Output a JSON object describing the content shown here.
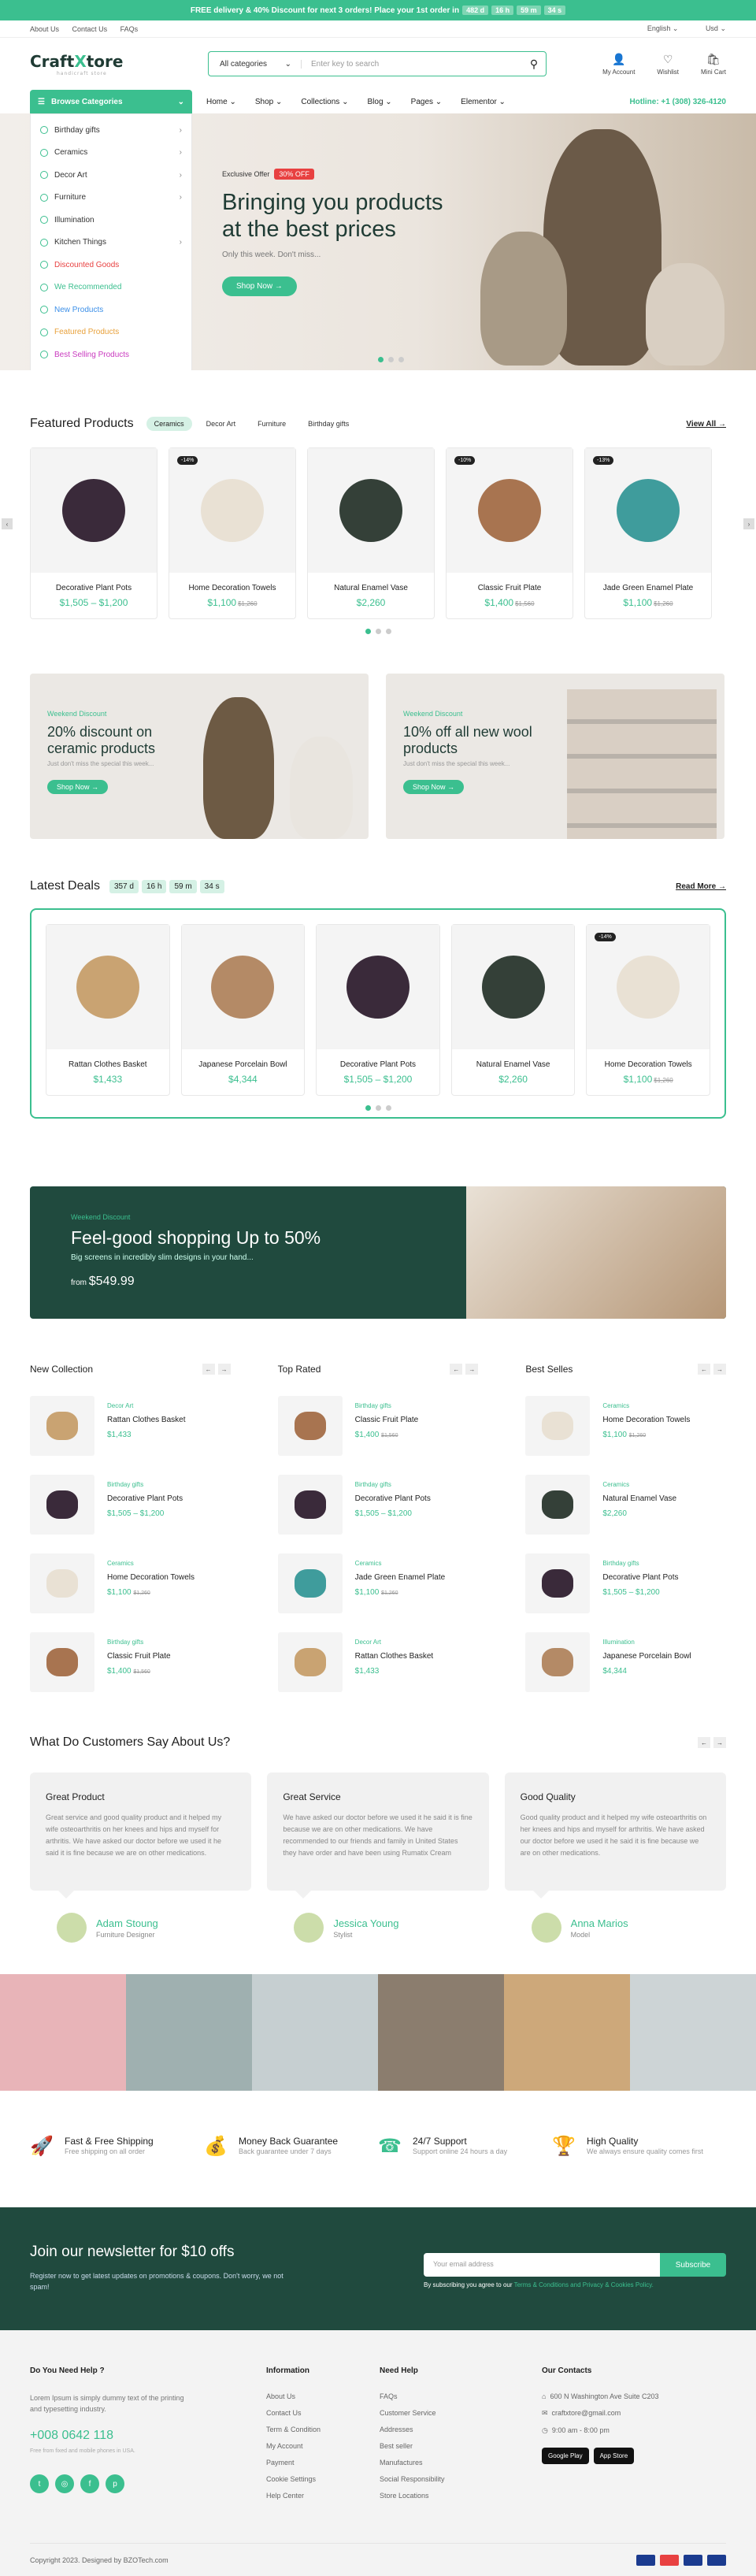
{
  "topbar": {
    "text": "FREE delivery & 40% Discount for next 3 orders! Place your 1st order in",
    "countdown": [
      "482 d",
      "16 h",
      "59 m",
      "34 s"
    ]
  },
  "util": {
    "links": [
      "About Us",
      "Contact Us",
      "FAQs"
    ],
    "language": "English",
    "currency": "Usd"
  },
  "logo": {
    "brand_a": "Craft",
    "brand_b": "X",
    "brand_c": "tore",
    "tagline": "handicraft store"
  },
  "search": {
    "category": "All categories",
    "placeholder": "Enter key to search"
  },
  "header_icons": [
    "My Account",
    "Wishlist",
    "Mini Cart"
  ],
  "browse": "Browse Categories",
  "nav": [
    "Home",
    "Shop",
    "Collections",
    "Blog",
    "Pages",
    "Elementor"
  ],
  "hotline": "Hotline: +1 (308) 326-4120",
  "categories": [
    {
      "label": "Birthday gifts",
      "arrow": true,
      "color": "#333"
    },
    {
      "label": "Ceramics",
      "arrow": true,
      "color": "#333"
    },
    {
      "label": "Decor Art",
      "arrow": true,
      "color": "#333"
    },
    {
      "label": "Furniture",
      "arrow": true,
      "color": "#333"
    },
    {
      "label": "Illumination",
      "arrow": false,
      "color": "#333"
    },
    {
      "label": "Kitchen Things",
      "arrow": true,
      "color": "#333"
    },
    {
      "label": "Discounted Goods",
      "arrow": false,
      "color": "#e84141"
    },
    {
      "label": "We Recommended",
      "arrow": false,
      "color": "#3bbf8f"
    },
    {
      "label": "New Products",
      "arrow": false,
      "color": "#3b8fe8"
    },
    {
      "label": "Featured Products",
      "arrow": false,
      "color": "#e8a13b"
    },
    {
      "label": "Best Selling Products",
      "arrow": false,
      "color": "#c93bbf"
    }
  ],
  "hero": {
    "offer": "Exclusive Offer",
    "badge": "30% OFF",
    "title_1": "Bringing you products",
    "title_2": "at the best prices",
    "subtitle": "Only this week. Don't miss...",
    "button": "Shop Now →"
  },
  "featured": {
    "title": "Featured Products",
    "tabs": [
      "Ceramics",
      "Decor Art",
      "Furniture",
      "Birthday gifts"
    ],
    "view_all": "View All →",
    "products": [
      {
        "name": "Decorative Plant Pots",
        "price": "$1,505 – $1,200",
        "old": "",
        "badge": "",
        "color": "#3a2a3a"
      },
      {
        "name": "Home Decoration Towels",
        "price": "$1,100",
        "old": "$1,260",
        "badge": "-14%",
        "color": "#e9e1d4"
      },
      {
        "name": "Natural Enamel Vase",
        "price": "$2,260",
        "old": "",
        "badge": "",
        "color": "#344038"
      },
      {
        "name": "Classic Fruit Plate",
        "price": "$1,400",
        "old": "$1,560",
        "badge": "-10%",
        "color": "#a87450"
      },
      {
        "name": "Jade Green Enamel Plate",
        "price": "$1,100",
        "old": "$1,260",
        "badge": "-13%",
        "color": "#3f9c9c"
      }
    ]
  },
  "banners": [
    {
      "tag": "Weekend Discount",
      "title_1": "20% discount on",
      "title_2": "ceramic products",
      "desc": "Just don't miss the special this week...",
      "button": "Shop Now →"
    },
    {
      "tag": "Weekend Discount",
      "title_1": "10% off all new wool",
      "title_2": "products",
      "desc": "Just don't miss the special this week...",
      "button": "Shop Now →"
    }
  ],
  "deals": {
    "title": "Latest Deals",
    "countdown": [
      "357 d",
      "16 h",
      "59 m",
      "34 s"
    ],
    "read_more": "Read More →",
    "products": [
      {
        "name": "Rattan Clothes Basket",
        "price": "$1,433",
        "old": "",
        "badge": "",
        "color": "#c9a372"
      },
      {
        "name": "Japanese Porcelain Bowl",
        "price": "$4,344",
        "old": "",
        "badge": "",
        "color": "#b48a66"
      },
      {
        "name": "Decorative Plant Pots",
        "price": "$1,505 – $1,200",
        "old": "",
        "badge": "",
        "color": "#3a2a3a"
      },
      {
        "name": "Natural Enamel Vase",
        "price": "$2,260",
        "old": "",
        "badge": "",
        "color": "#344038"
      },
      {
        "name": "Home Decoration Towels",
        "price": "$1,100",
        "old": "$1,260",
        "badge": "-14%",
        "color": "#e9e1d4"
      }
    ]
  },
  "promo": {
    "tag": "Weekend Discount",
    "title": "Feel-good shopping Up to 50%",
    "desc": "Big screens in incredibly slim designs in your hand...",
    "from": "from",
    "price": "$549.99"
  },
  "lists": [
    {
      "title": "New Collection",
      "items": [
        {
          "cat": "Decor Art",
          "name": "Rattan Clothes Basket",
          "price": "$1,433",
          "old": "",
          "color": "#c9a372"
        },
        {
          "cat": "Birthday gifts",
          "name": "Decorative Plant Pots",
          "price": "$1,505 – $1,200",
          "old": "",
          "color": "#3a2a3a"
        },
        {
          "cat": "Ceramics",
          "name": "Home Decoration Towels",
          "price": "$1,100",
          "old": "$1,260",
          "color": "#e9e1d4"
        },
        {
          "cat": "Birthday gifts",
          "name": "Classic Fruit Plate",
          "price": "$1,400",
          "old": "$1,560",
          "color": "#a87450"
        }
      ]
    },
    {
      "title": "Top Rated",
      "items": [
        {
          "cat": "Birthday gifts",
          "name": "Classic Fruit Plate",
          "price": "$1,400",
          "old": "$1,560",
          "color": "#a87450"
        },
        {
          "cat": "Birthday gifts",
          "name": "Decorative Plant Pots",
          "price": "$1,505 – $1,200",
          "old": "",
          "color": "#3a2a3a"
        },
        {
          "cat": "Ceramics",
          "name": "Jade Green Enamel Plate",
          "price": "$1,100",
          "old": "$1,260",
          "color": "#3f9c9c"
        },
        {
          "cat": "Decor Art",
          "name": "Rattan Clothes Basket",
          "price": "$1,433",
          "old": "",
          "color": "#c9a372"
        }
      ]
    },
    {
      "title": "Best Selles",
      "items": [
        {
          "cat": "Ceramics",
          "name": "Home Decoration Towels",
          "price": "$1,100",
          "old": "$1,260",
          "color": "#e9e1d4"
        },
        {
          "cat": "Ceramics",
          "name": "Natural Enamel Vase",
          "price": "$2,260",
          "old": "",
          "color": "#344038"
        },
        {
          "cat": "Birthday gifts",
          "name": "Decorative Plant Pots",
          "price": "$1,505 – $1,200",
          "old": "",
          "color": "#3a2a3a"
        },
        {
          "cat": "Illumination",
          "name": "Japanese Porcelain Bowl",
          "price": "$4,344",
          "old": "",
          "color": "#b48a66"
        }
      ]
    }
  ],
  "testimonials": {
    "title": "What Do Customers Say About Us?",
    "items": [
      {
        "head": "Great Product",
        "text": "Great service and good quality product and it helped my wife osteoarthritis on her knees and hips and myself for arthritis. We have asked our doctor before we used it he said it is fine because we are on other medications.",
        "name": "Adam Stoung",
        "role": "Furniture Designer"
      },
      {
        "head": "Great Service",
        "text": "We have asked our doctor before we used it he said it is fine because we are on other medications. We have recommended to our friends and family in United States they have order and have been using Rumatix Cream",
        "name": "Jessica Young",
        "role": "Stylist"
      },
      {
        "head": "Good Quality",
        "text": "Good quality product and it helped my wife osteoarthritis on her knees and hips and myself for arthritis. We have asked our doctor before we used it he said it is fine because we are on other medications.",
        "name": "Anna Marios",
        "role": "Model"
      }
    ]
  },
  "gallery": [
    "#e8b4b8",
    "#9fb0b0",
    "#c6cfd1",
    "#8b7d6e",
    "#cda87a",
    "#cdd4d6"
  ],
  "features": [
    {
      "title": "Fast & Free Shipping",
      "desc": "Free shipping on all order"
    },
    {
      "title": "Money Back Guarantee",
      "desc": "Back guarantee under 7 days"
    },
    {
      "title": "24/7 Support",
      "desc": "Support online 24 hours a day"
    },
    {
      "title": "High Quality",
      "desc": "We always ensure quality comes first"
    }
  ],
  "newsletter": {
    "title": "Join our newsletter for $10 offs",
    "desc": "Register now to get latest updates on promotions & coupons. Don't worry, we not spam!",
    "placeholder": "Your email address",
    "button": "Subscribe",
    "note": "By subscribing you agree to our",
    "terms": "Terms & Conditions and Privacy & Cookies Policy."
  },
  "footer": {
    "help_title": "Do You Need Help ?",
    "help_text": "Lorem Ipsum is simply dummy text of the printing and typesetting industry.",
    "phone": "+008 0642 118",
    "phone_note": "Free from fixed and mobile phones in USA.",
    "info_title": "Information",
    "info": [
      "About Us",
      "Contact Us",
      "Term & Condition",
      "My Account",
      "Payment",
      "Cookie Settings",
      "Help Center"
    ],
    "need_title": "Need Help",
    "need": [
      "FAQs",
      "Customer Service",
      "Addresses",
      "Best seller",
      "Manufactures",
      "Social Responsibility",
      "Store Locations"
    ],
    "contact_title": "Our Contacts",
    "address": "600 N Washington Ave Suite C203",
    "email": "craftxtore@gmail.com",
    "hours": "9:00 am - 8:00 pm",
    "gplay": "Google Play",
    "appstore": "App Store",
    "copyright": "Copyright 2023. Designed by BZOTech.com"
  }
}
